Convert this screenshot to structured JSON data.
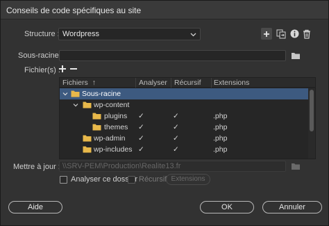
{
  "window": {
    "title": "Conseils de code spécifiques au site"
  },
  "structure": {
    "label": "Structure :",
    "value": "Wordpress"
  },
  "toolbar": {
    "icons": [
      "add-icon",
      "import-export-icon",
      "info-icon",
      "trash-icon"
    ]
  },
  "subroot": {
    "label": "Sous-racine :",
    "value": ""
  },
  "files": {
    "label": "Fichier(s) :"
  },
  "grid": {
    "columns": [
      "Fichiers",
      "Analyser",
      "Récursif",
      "Extensions"
    ],
    "sort_indicator": "↑",
    "check_glyph": "✓",
    "rows": [
      {
        "name": "Sous-racine",
        "analyse": "",
        "recursif": "",
        "extensions": "",
        "selected": true
      },
      {
        "name": "wp-content",
        "analyse": "",
        "recursif": "",
        "extensions": ""
      },
      {
        "name": "plugins",
        "analyse": "✓",
        "recursif": "✓",
        "extensions": ".php"
      },
      {
        "name": "themes",
        "analyse": "✓",
        "recursif": "✓",
        "extensions": ".php"
      },
      {
        "name": "wp-admin",
        "analyse": "✓",
        "recursif": "✓",
        "extensions": ".php"
      },
      {
        "name": "wp-includes",
        "analyse": "✓",
        "recursif": "✓",
        "extensions": ".php"
      }
    ]
  },
  "update": {
    "label": "Mettre à jour :",
    "value": "\\\\SRV-PEM\\Production\\Realite13.fr"
  },
  "options": {
    "analyse_folder": "Analyser ce dossier",
    "recursive": "Récursif",
    "extensions": "Extensions"
  },
  "buttons": {
    "help": "Aide",
    "ok": "OK",
    "cancel": "Annuler"
  },
  "colors": {
    "selection": "#3d5a80",
    "folder": "#e8b84a",
    "background": "#323232"
  }
}
